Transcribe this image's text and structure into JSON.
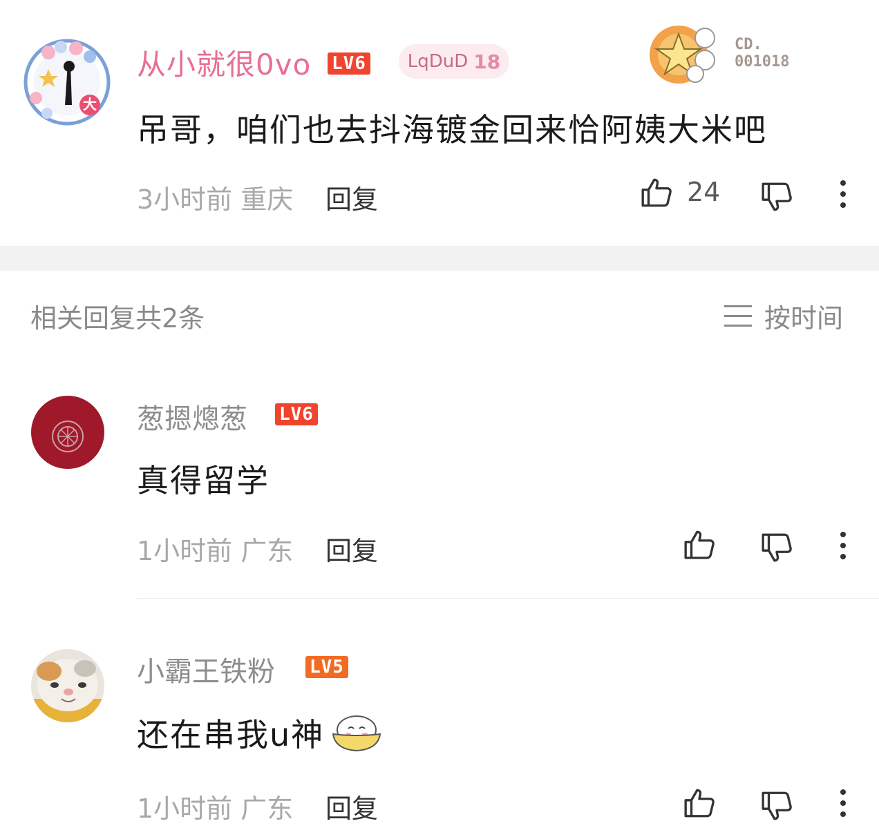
{
  "top_comment": {
    "username": "从小就很0vo",
    "level": "LV6",
    "fan_badge": {
      "name": "LqDuD",
      "level": "18"
    },
    "decoration_code": [
      "CD.",
      "001018"
    ],
    "text": "吊哥，咱们也去抖海镀金回来恰阿姨大米吧",
    "time": "3小时前",
    "location": "重庆",
    "reply_label": "回复",
    "like_count": "24"
  },
  "replies_header": {
    "title": "相关回复共2条",
    "sort_label": "按时间"
  },
  "replies": [
    {
      "username": "葱摁熜葱",
      "level": "LV6",
      "text": "真得留学",
      "time": "1小时前",
      "location": "广东",
      "reply_label": "回复"
    },
    {
      "username": "小霸王铁粉",
      "level": "LV5",
      "text": "还在串我u神",
      "time": "1小时前",
      "location": "广东",
      "reply_label": "回复"
    }
  ],
  "colors": {
    "username_pink": "#e86f92",
    "level6": "#f0442e",
    "level5": "#f26b22",
    "separator": "#f2f2f2"
  }
}
